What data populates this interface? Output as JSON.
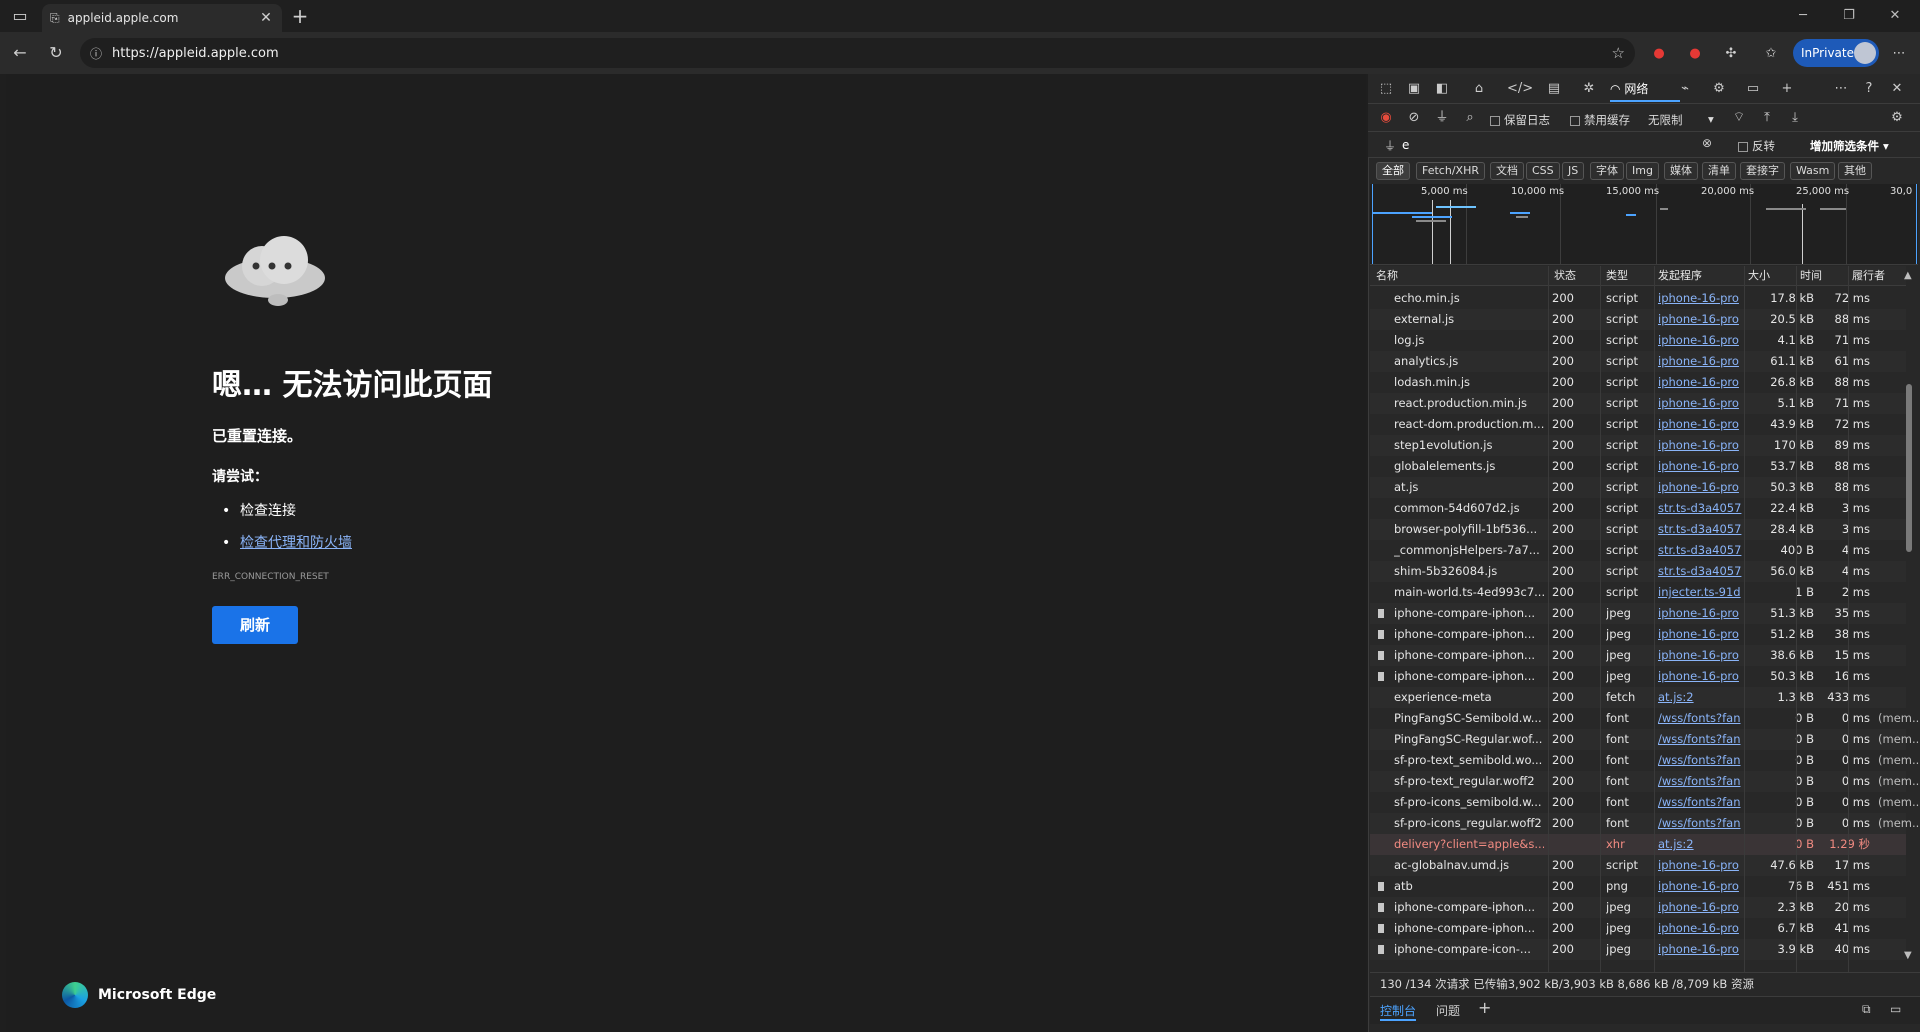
{
  "browser": {
    "tab_title": "appleid.apple.com",
    "url": "https://appleid.apple.com",
    "inprivate_label": "InPrivate"
  },
  "error_page": {
    "title": "嗯… 无法访问此页面",
    "subtitle": "已重置连接。",
    "try_label": "请尝试：",
    "suggestions": [
      "检查连接",
      "检查代理和防火墙"
    ],
    "error_code": "ERR_CONNECTION_RESET",
    "refresh_label": "刷新",
    "brand": "Microsoft Edge"
  },
  "devtools": {
    "network_tab_label": "网络",
    "preserve_log": "保留日志",
    "disable_cache": "禁用缓存",
    "throttle": "无限制",
    "filter_value": "e",
    "invert_label": "反转",
    "more_filters": "增加筛选条件",
    "type_filters": [
      "全部",
      "Fetch/XHR",
      "文档",
      "CSS",
      "JS",
      "字体",
      "Img",
      "媒体",
      "清单",
      "套接字",
      "Wasm",
      "其他"
    ],
    "timeline_ticks": [
      "5,000 ms",
      "10,000 ms",
      "15,000 ms",
      "20,000 ms",
      "25,000 ms",
      "30,0"
    ],
    "columns": [
      "名称",
      "状态",
      "类型",
      "发起程序",
      "大小",
      "时间",
      "履行者"
    ],
    "rows": [
      {
        "name": "echo.min.js",
        "status": "200",
        "type": "script",
        "initiator": "iphone-16-pro",
        "size": "17.8 kB",
        "time": "72 ms",
        "by": ""
      },
      {
        "name": "external.js",
        "status": "200",
        "type": "script",
        "initiator": "iphone-16-pro",
        "size": "20.5 kB",
        "time": "88 ms",
        "by": ""
      },
      {
        "name": "log.js",
        "status": "200",
        "type": "script",
        "initiator": "iphone-16-pro",
        "size": "4.1 kB",
        "time": "71 ms",
        "by": ""
      },
      {
        "name": "analytics.js",
        "status": "200",
        "type": "script",
        "initiator": "iphone-16-pro",
        "size": "61.1 kB",
        "time": "61 ms",
        "by": ""
      },
      {
        "name": "lodash.min.js",
        "status": "200",
        "type": "script",
        "initiator": "iphone-16-pro",
        "size": "26.8 kB",
        "time": "88 ms",
        "by": ""
      },
      {
        "name": "react.production.min.js",
        "status": "200",
        "type": "script",
        "initiator": "iphone-16-pro",
        "size": "5.1 kB",
        "time": "71 ms",
        "by": ""
      },
      {
        "name": "react-dom.production.m...",
        "status": "200",
        "type": "script",
        "initiator": "iphone-16-pro",
        "size": "43.9 kB",
        "time": "72 ms",
        "by": ""
      },
      {
        "name": "step1evolution.js",
        "status": "200",
        "type": "script",
        "initiator": "iphone-16-pro",
        "size": "170 kB",
        "time": "89 ms",
        "by": ""
      },
      {
        "name": "globalelements.js",
        "status": "200",
        "type": "script",
        "initiator": "iphone-16-pro",
        "size": "53.7 kB",
        "time": "88 ms",
        "by": ""
      },
      {
        "name": "at.js",
        "status": "200",
        "type": "script",
        "initiator": "iphone-16-pro",
        "size": "50.3 kB",
        "time": "88 ms",
        "by": ""
      },
      {
        "name": "common-54d607d2.js",
        "status": "200",
        "type": "script",
        "initiator": "str.ts-d3a4057",
        "size": "22.4 kB",
        "time": "3 ms",
        "by": ""
      },
      {
        "name": "browser-polyfill-1bf536...",
        "status": "200",
        "type": "script",
        "initiator": "str.ts-d3a4057",
        "size": "28.4 kB",
        "time": "3 ms",
        "by": ""
      },
      {
        "name": "_commonjsHelpers-7a7...",
        "status": "200",
        "type": "script",
        "initiator": "str.ts-d3a4057",
        "size": "400 B",
        "time": "4 ms",
        "by": ""
      },
      {
        "name": "shim-5b326084.js",
        "status": "200",
        "type": "script",
        "initiator": "str.ts-d3a4057",
        "size": "56.0 kB",
        "time": "4 ms",
        "by": ""
      },
      {
        "name": "main-world.ts-4ed993c7...",
        "status": "200",
        "type": "script",
        "initiator": "injecter.ts-91d",
        "size": "1 B",
        "time": "2 ms",
        "by": ""
      },
      {
        "name": "iphone-compare-iphon...",
        "status": "200",
        "type": "jpeg",
        "initiator": "iphone-16-pro",
        "size": "51.3 kB",
        "time": "35 ms",
        "by": "",
        "icon": true
      },
      {
        "name": "iphone-compare-iphon...",
        "status": "200",
        "type": "jpeg",
        "initiator": "iphone-16-pro",
        "size": "51.2 kB",
        "time": "38 ms",
        "by": "",
        "icon": true
      },
      {
        "name": "iphone-compare-iphon...",
        "status": "200",
        "type": "jpeg",
        "initiator": "iphone-16-pro",
        "size": "38.6 kB",
        "time": "15 ms",
        "by": "",
        "icon": true
      },
      {
        "name": "iphone-compare-iphon...",
        "status": "200",
        "type": "jpeg",
        "initiator": "iphone-16-pro",
        "size": "50.3 kB",
        "time": "16 ms",
        "by": "",
        "icon": true
      },
      {
        "name": "experience-meta",
        "status": "200",
        "type": "fetch",
        "initiator": "at.js:2",
        "size": "1.3 kB",
        "time": "433 ms",
        "by": ""
      },
      {
        "name": "PingFangSC-Semibold.w...",
        "status": "200",
        "type": "font",
        "initiator": "/wss/fonts?fan",
        "size": "0 B",
        "time": "0 ms",
        "by": "(mem..."
      },
      {
        "name": "PingFangSC-Regular.wof...",
        "status": "200",
        "type": "font",
        "initiator": "/wss/fonts?fan",
        "size": "0 B",
        "time": "0 ms",
        "by": "(mem..."
      },
      {
        "name": "sf-pro-text_semibold.wo...",
        "status": "200",
        "type": "font",
        "initiator": "/wss/fonts?fan",
        "size": "0 B",
        "time": "0 ms",
        "by": "(mem..."
      },
      {
        "name": "sf-pro-text_regular.woff2",
        "status": "200",
        "type": "font",
        "initiator": "/wss/fonts?fan",
        "size": "0 B",
        "time": "0 ms",
        "by": "(mem..."
      },
      {
        "name": "sf-pro-icons_semibold.w...",
        "status": "200",
        "type": "font",
        "initiator": "/wss/fonts?fan",
        "size": "0 B",
        "time": "0 ms",
        "by": "(mem..."
      },
      {
        "name": "sf-pro-icons_regular.woff2",
        "status": "200",
        "type": "font",
        "initiator": "/wss/fonts?fan",
        "size": "0 B",
        "time": "0 ms",
        "by": "(mem..."
      },
      {
        "name": "delivery?client=apple&s...",
        "status": "",
        "type": "xhr",
        "initiator": "at.js:2",
        "size": "0 B",
        "time": "1.29 秒",
        "by": "",
        "error": true
      },
      {
        "name": "ac-globalnav.umd.js",
        "status": "200",
        "type": "script",
        "initiator": "iphone-16-pro",
        "size": "47.6 kB",
        "time": "17 ms",
        "by": ""
      },
      {
        "name": "atb",
        "status": "200",
        "type": "png",
        "initiator": "iphone-16-pro",
        "size": "76 B",
        "time": "451 ms",
        "by": "",
        "icon": true
      },
      {
        "name": "iphone-compare-iphon...",
        "status": "200",
        "type": "jpeg",
        "initiator": "iphone-16-pro",
        "size": "2.3 kB",
        "time": "20 ms",
        "by": "",
        "icon": true
      },
      {
        "name": "iphone-compare-iphon...",
        "status": "200",
        "type": "jpeg",
        "initiator": "iphone-16-pro",
        "size": "6.7 kB",
        "time": "41 ms",
        "by": "",
        "icon": true
      },
      {
        "name": "iphone-compare-icon-...",
        "status": "200",
        "type": "jpeg",
        "initiator": "iphone-16-pro",
        "size": "3.9 kB",
        "time": "40 ms",
        "by": "",
        "icon": true
      }
    ],
    "status_bar": "130 /134 次请求   已传输3,902 kB/3,903 kB   8,686 kB /8,709 kB 资源",
    "drawer_tabs": [
      "控制台",
      "问题"
    ]
  },
  "colors": {
    "accent": "#1a73e8",
    "link": "#8ab4f8",
    "error_row": "#f28b82",
    "inprivate": "#1e5ab8"
  }
}
